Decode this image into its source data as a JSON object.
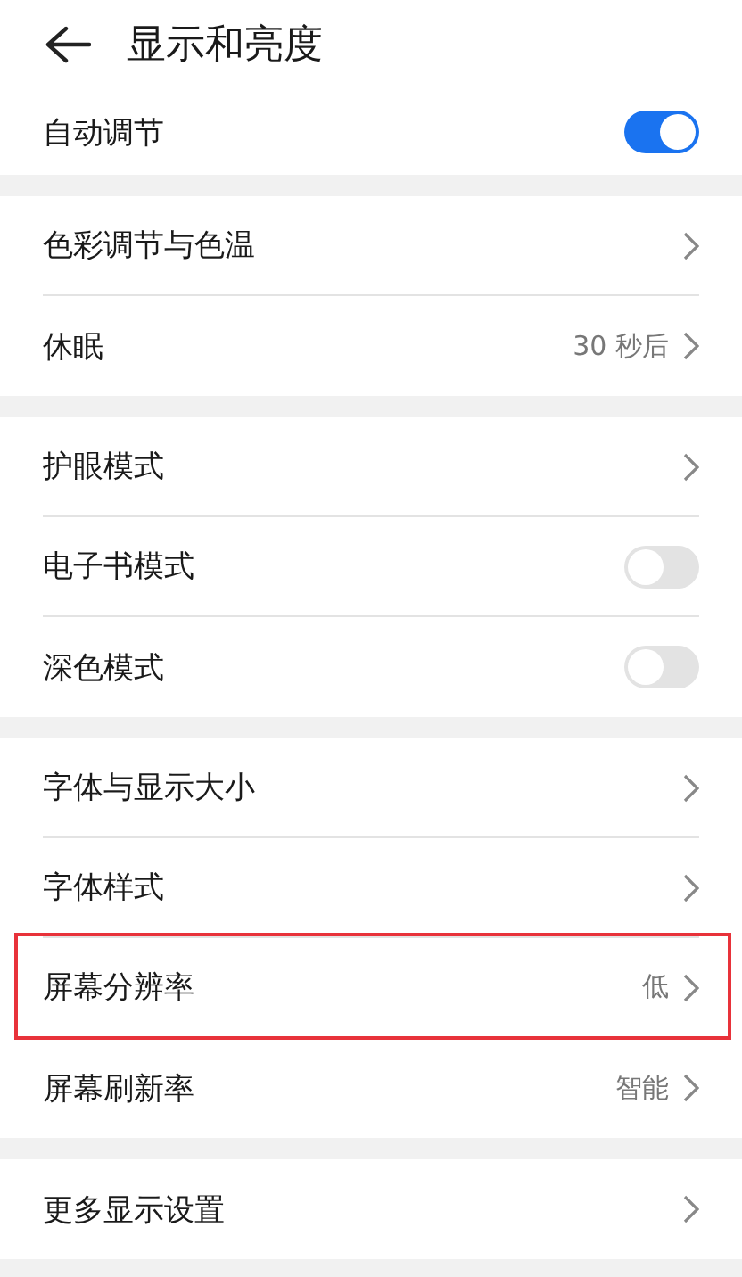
{
  "header": {
    "title": "显示和亮度"
  },
  "groups": [
    {
      "items": [
        {
          "kind": "toggle",
          "label": "自动调节",
          "on": true
        }
      ]
    },
    {
      "items": [
        {
          "kind": "link",
          "label": "色彩调节与色温"
        },
        {
          "kind": "link",
          "label": "休眠",
          "value": "30 秒后"
        }
      ]
    },
    {
      "items": [
        {
          "kind": "link",
          "label": "护眼模式"
        },
        {
          "kind": "toggle",
          "label": "电子书模式",
          "on": false
        },
        {
          "kind": "toggle",
          "label": "深色模式",
          "on": false
        }
      ]
    },
    {
      "items": [
        {
          "kind": "link",
          "label": "字体与显示大小"
        },
        {
          "kind": "link",
          "label": "字体样式"
        },
        {
          "kind": "link",
          "label": "屏幕分辨率",
          "value": "低",
          "highlighted": true
        },
        {
          "kind": "link",
          "label": "屏幕刷新率",
          "value": "智能"
        }
      ]
    },
    {
      "items": [
        {
          "kind": "link",
          "label": "更多显示设置"
        }
      ]
    }
  ]
}
